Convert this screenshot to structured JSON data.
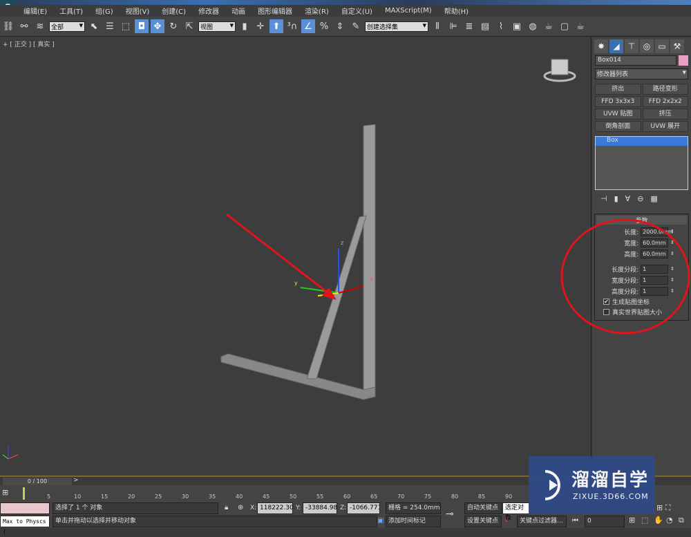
{
  "menu": [
    "编辑(E)",
    "工具(T)",
    "组(G)",
    "视图(V)",
    "创建(C)",
    "修改器",
    "动画",
    "图形编辑器",
    "渲染(R)",
    "自定义(U)",
    "MAXScript(M)",
    "帮助(H)"
  ],
  "toolbar": {
    "selection_filter": "全部",
    "ref_coord": "视图",
    "named_selection": "创建选择集"
  },
  "viewport": {
    "label": "+ [ 正交 ] [ 真实 ]",
    "annotation_color": "#e0141a"
  },
  "panel": {
    "object_name": "Box014",
    "object_color": "#e6a0c4",
    "modifier_list": "修改器列表",
    "modifier_buttons": [
      "挤出",
      "路径变形",
      "FFD 3x3x3",
      "FFD 2x2x2",
      "UVW 贴图",
      "挤压",
      "倒角剖面",
      "UVW 展开"
    ],
    "stack": [
      "Box"
    ],
    "rollout_title": "参数",
    "params": [
      {
        "label": "长度:",
        "value": "2000.0mm"
      },
      {
        "label": "宽度:",
        "value": "60.0mm"
      },
      {
        "label": "高度:",
        "value": "60.0mm"
      },
      {
        "label": "长度分段:",
        "value": "1"
      },
      {
        "label": "宽度分段:",
        "value": "1"
      },
      {
        "label": "高度分段:",
        "value": "1"
      }
    ],
    "checks": [
      {
        "label": "生成贴图坐标",
        "checked": true
      },
      {
        "label": "真实世界贴图大小",
        "checked": false
      }
    ]
  },
  "timeline": {
    "frame": "0 / 100",
    "ticks": [
      "5",
      "10",
      "15",
      "20",
      "25",
      "30",
      "35",
      "40",
      "45",
      "50",
      "55",
      "60",
      "65",
      "70",
      "75",
      "80",
      "85",
      "90"
    ]
  },
  "status": {
    "script": "Max to Physcs (",
    "selected": "选择了 1 个 对象",
    "hint": "单击并拖动以选择并移动对象",
    "x": "118222.30",
    "y": "-33884.98",
    "z": "-1066.771",
    "grid": "栅格 = 254.0mm",
    "auto_key": "自动关键点",
    "set_key": "设置关键点",
    "key_mode": "选定对象",
    "key_filter": "关键点过滤器...",
    "add_time_tag": "添加时间标记",
    "frame_field": "0"
  },
  "watermark": {
    "name": "溜溜自学",
    "url": "ZIXUE.3D66.COM"
  }
}
